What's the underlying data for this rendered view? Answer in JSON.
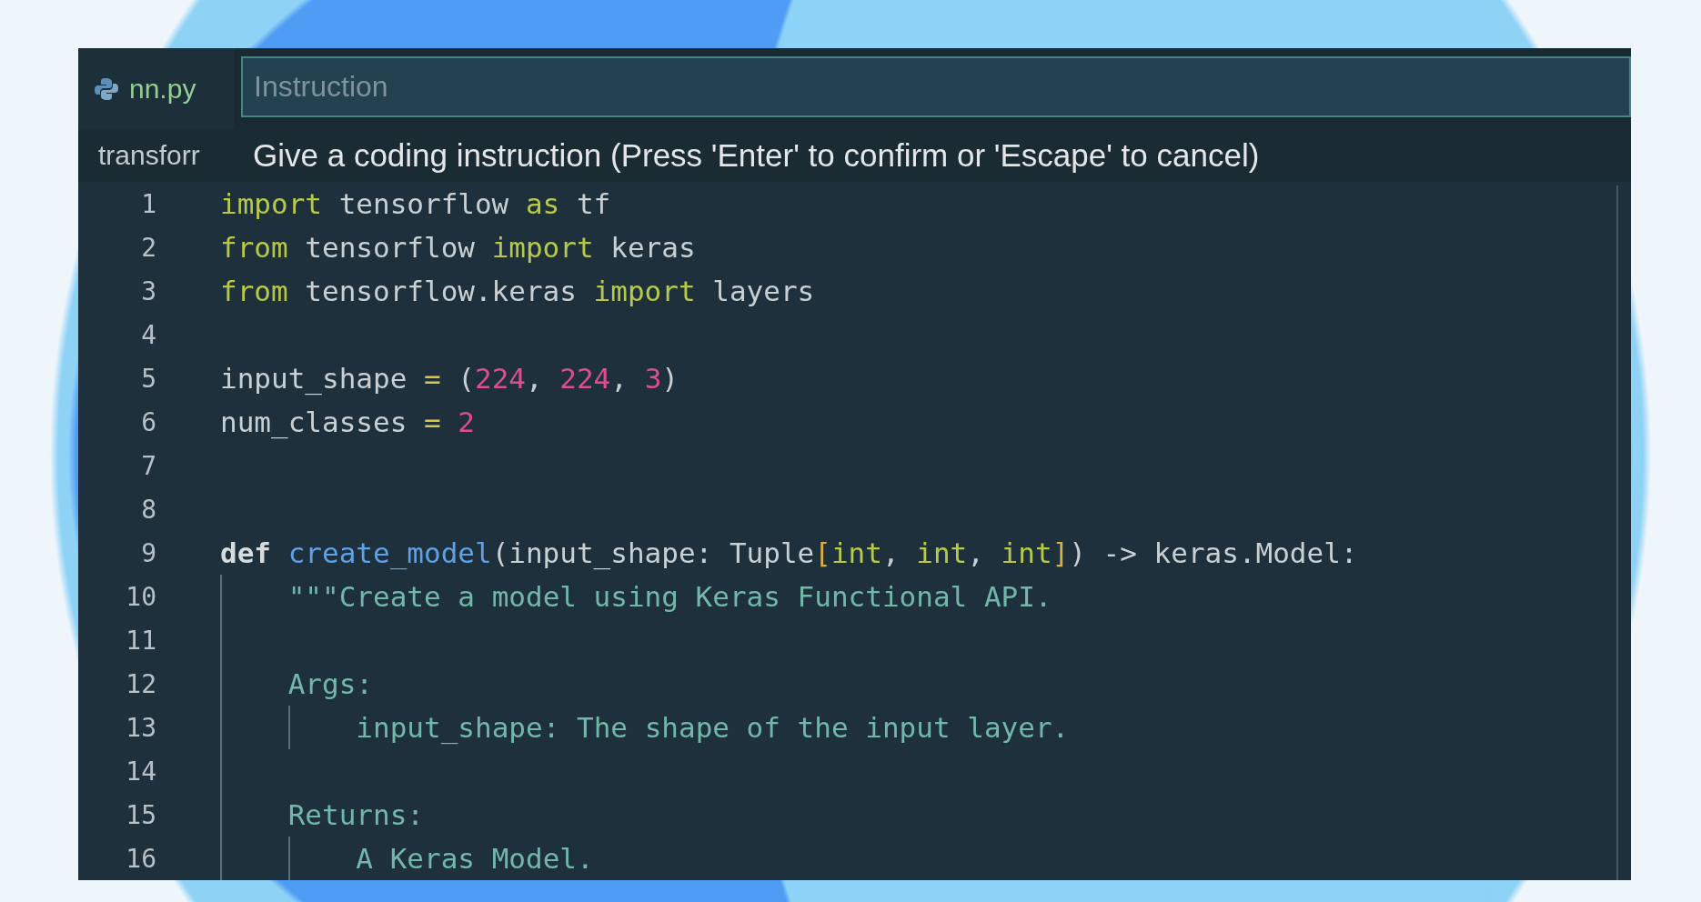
{
  "tab": {
    "label": "nn.py"
  },
  "instruction_field": {
    "placeholder": "Instruction"
  },
  "breadcrumb": "transforr",
  "hint": "Give a coding instruction (Press 'Enter' to confirm or 'Escape' to cancel)",
  "lines": [
    {
      "number": "1",
      "tokens": [
        {
          "text": "import",
          "kind": "keyword"
        },
        {
          "text": " tensorflow ",
          "kind": "plain"
        },
        {
          "text": "as",
          "kind": "keyword"
        },
        {
          "text": " tf",
          "kind": "plain"
        }
      ]
    },
    {
      "number": "2",
      "tokens": [
        {
          "text": "from",
          "kind": "keyword"
        },
        {
          "text": " tensorflow ",
          "kind": "plain"
        },
        {
          "text": "import",
          "kind": "keyword"
        },
        {
          "text": " keras",
          "kind": "plain"
        }
      ]
    },
    {
      "number": "3",
      "tokens": [
        {
          "text": "from",
          "kind": "keyword"
        },
        {
          "text": " tensorflow.keras ",
          "kind": "plain"
        },
        {
          "text": "import",
          "kind": "keyword"
        },
        {
          "text": " layers",
          "kind": "plain"
        }
      ]
    },
    {
      "number": "4"
    },
    {
      "number": "5",
      "tokens": [
        {
          "text": "input_shape ",
          "kind": "plain"
        },
        {
          "text": "=",
          "kind": "operator"
        },
        {
          "text": " (",
          "kind": "plain"
        },
        {
          "text": "224",
          "kind": "number"
        },
        {
          "text": ", ",
          "kind": "plain"
        },
        {
          "text": "224",
          "kind": "number"
        },
        {
          "text": ", ",
          "kind": "plain"
        },
        {
          "text": "3",
          "kind": "number"
        },
        {
          "text": ")",
          "kind": "plain"
        }
      ]
    },
    {
      "number": "6",
      "tokens": [
        {
          "text": "num_classes ",
          "kind": "plain"
        },
        {
          "text": "= ",
          "kind": "operator"
        },
        {
          "text": "2",
          "kind": "number"
        }
      ]
    },
    {
      "number": "7"
    },
    {
      "number": "8"
    },
    {
      "number": "9",
      "tokens": [
        {
          "text": "def ",
          "kind": "def"
        },
        {
          "text": "create_model",
          "kind": "function"
        },
        {
          "text": "(input_shape: Tuple",
          "kind": "plain"
        },
        {
          "text": "[",
          "kind": "bracket"
        },
        {
          "text": "int",
          "kind": "keyword"
        },
        {
          "text": ", ",
          "kind": "plain"
        },
        {
          "text": "int",
          "kind": "keyword"
        },
        {
          "text": ", ",
          "kind": "plain"
        },
        {
          "text": "int",
          "kind": "keyword"
        },
        {
          "text": "]",
          "kind": "bracket"
        },
        {
          "text": ") -> keras.Model:",
          "kind": "plain"
        }
      ],
      "children": [
        {
          "number": "10",
          "tokens": [
            {
              "text": "\"\"\"Create a model using Keras Functional API.",
              "kind": "string"
            }
          ]
        },
        {
          "number": "11"
        },
        {
          "number": "12",
          "tokens": [
            {
              "text": "Args:",
              "kind": "string"
            }
          ],
          "children": [
            {
              "number": "13",
              "tokens": [
                {
                  "text": "input_shape: The shape of the input layer.",
                  "kind": "string"
                }
              ]
            }
          ]
        },
        {
          "number": "14"
        },
        {
          "number": "15",
          "tokens": [
            {
              "text": "Returns:",
              "kind": "string"
            }
          ],
          "children": [
            {
              "number": "16",
              "tokens": [
                {
                  "text": "A Keras Model.",
                  "kind": "string"
                }
              ]
            }
          ]
        }
      ]
    }
  ]
}
